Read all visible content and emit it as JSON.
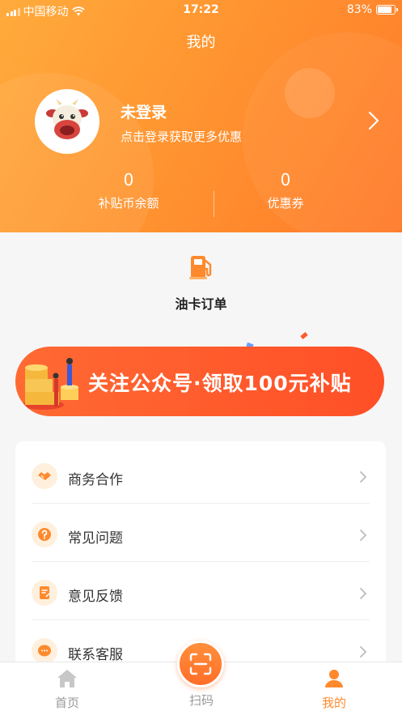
{
  "status_bar": {
    "carrier": "中国移动",
    "time": "17:22",
    "battery": "83%"
  },
  "page": {
    "title": "我的"
  },
  "profile": {
    "name": "未登录",
    "subtitle": "点击登录获取更多优惠"
  },
  "stats": [
    {
      "value": "0",
      "label": "补贴币余额"
    },
    {
      "value": "0",
      "label": "优惠券"
    }
  ],
  "quick_action": {
    "label": "油卡订单",
    "icon": "fuel-pump-icon"
  },
  "banner": {
    "text": "关注公众号·领取100元补贴"
  },
  "menu": [
    {
      "label": "商务合作",
      "icon": "handshake-icon"
    },
    {
      "label": "常见问题",
      "icon": "question-icon"
    },
    {
      "label": "意见反馈",
      "icon": "feedback-icon"
    },
    {
      "label": "联系客服",
      "icon": "chat-icon"
    }
  ],
  "tabs": [
    {
      "label": "首页",
      "icon": "home-icon",
      "active": false
    },
    {
      "label": "扫码",
      "icon": "scan-icon",
      "active": false
    },
    {
      "label": "我的",
      "icon": "user-icon",
      "active": true
    }
  ],
  "colors": {
    "accent": "#ff8a2e",
    "inactive": "#999999",
    "banner": "#ff5a2c"
  }
}
